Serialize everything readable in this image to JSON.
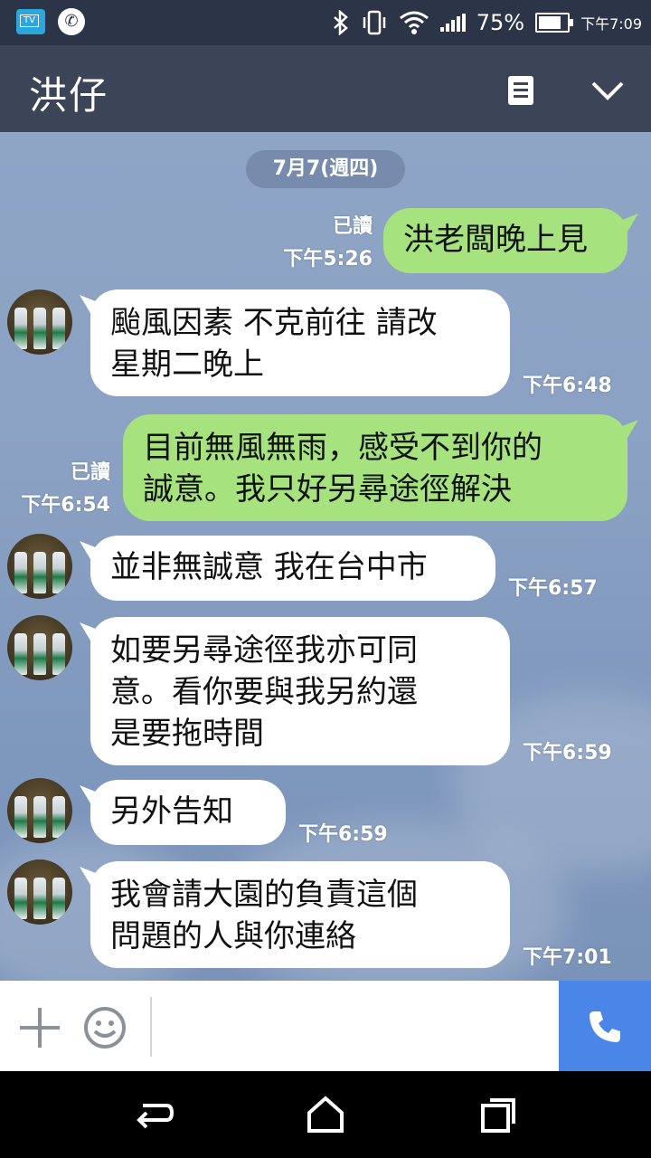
{
  "status_bar": {
    "battery": "75%",
    "time": "下午7:09"
  },
  "header": {
    "title": "洪仔"
  },
  "chat": {
    "date": "7月7(週四)",
    "messages": [
      {
        "side": "out",
        "text": "洪老闆晚上見",
        "read": "已讀",
        "time": "下午5:26"
      },
      {
        "side": "in",
        "text": "颱風因素 不克前往 請改\n星期二晚上",
        "time": "下午6:48"
      },
      {
        "side": "out",
        "text": "目前無風無雨，感受不到你的\n誠意。我只好另尋途徑解決",
        "read": "已讀",
        "time": "下午6:54"
      },
      {
        "side": "in",
        "text": "並非無誠意 我在台中市",
        "time": "下午6:57"
      },
      {
        "side": "in",
        "text": "如要另尋途徑我亦可同\n意。看你要與我另約還\n是要拖時間",
        "time": "下午6:59"
      },
      {
        "side": "in",
        "text": "另外告知",
        "time": "下午6:59"
      },
      {
        "side": "in",
        "text": "我會請大園的負責這個\n問題的人與你連絡",
        "time": "下午7:01"
      }
    ]
  },
  "input": {
    "placeholder": ""
  },
  "colors": {
    "header": "#3b4557",
    "status_bar": "#2b3547",
    "outgoing_bubble": "#a6e27e",
    "incoming_bubble": "#ffffff",
    "call_button": "#4a86e8"
  }
}
